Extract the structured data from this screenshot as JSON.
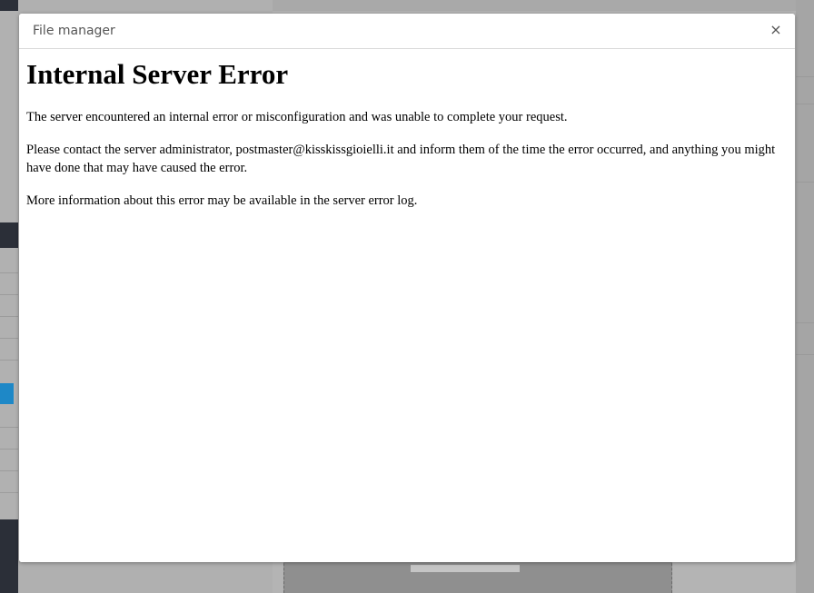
{
  "dialog": {
    "title": "File manager",
    "close_label": "×"
  },
  "error_page": {
    "heading": "Internal Server Error",
    "paragraphs": [
      "The server encountered an internal error or misconfiguration and was unable to complete your request.",
      "Please contact the server administrator, postmaster@kisskissgioielli.it and inform them of the time the error occurred, and anything you might have done that may have caused the error.",
      "More information about this error may be available in the server error log."
    ]
  },
  "colors": {
    "overlay": "#a9a9a9",
    "dialog_bg": "#ffffff",
    "sidebar_dark": "#2b2f38",
    "accent": "#1e88c7"
  }
}
